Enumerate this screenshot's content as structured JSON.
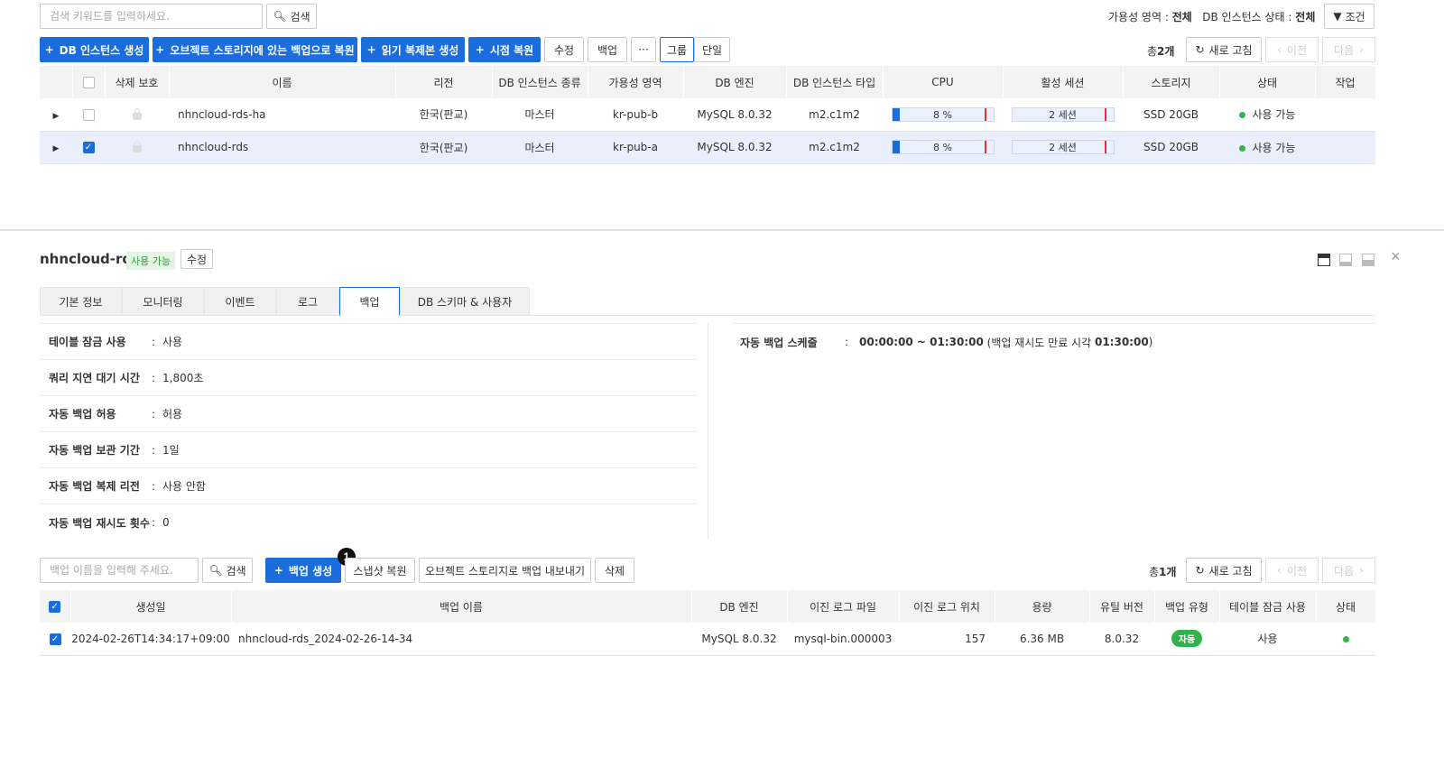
{
  "top": {
    "search_placeholder": "검색 키워드를 입력하세요.",
    "search_button": "검색",
    "filter_zone_label": "가용성 영역 :",
    "filter_zone_value": "전체",
    "filter_status_label": "DB 인스턴스 상태 :",
    "filter_status_value": "전체",
    "condition_button": "조건"
  },
  "toolbar": {
    "create_instance": "DB 인스턴스 생성",
    "restore_object_storage": "오브젝트 스토리지에 있는 백업으로 복원",
    "create_read_replica": "읽기 복제본 생성",
    "point_in_time_restore": "시점 복원",
    "edit": "수정",
    "backup": "백업",
    "more": "···",
    "group": "그룹",
    "single": "단일",
    "total_prefix": "총",
    "total_count": "2개",
    "refresh": "새로 고침",
    "prev": "이전",
    "next": "다음"
  },
  "instances_table": {
    "headers": [
      "삭제 보호",
      "이름",
      "리전",
      "DB 인스턴스 종류",
      "가용성 영역",
      "DB 엔진",
      "DB 인스턴스 타입",
      "CPU",
      "활성 세션",
      "스토리지",
      "상태",
      "작업"
    ],
    "rows": [
      {
        "name": "nhncloud-rds-ha",
        "region": "한국(판교)",
        "kind": "마스터",
        "zone": "kr-pub-b",
        "engine": "MySQL 8.0.32",
        "type": "m2.c1m2",
        "cpu": "8 %",
        "cpu_pct": 8,
        "sessions": "2 세션",
        "storage": "SSD 20GB",
        "status": "사용 가능",
        "checked": false
      },
      {
        "name": "nhncloud-rds",
        "region": "한국(판교)",
        "kind": "마스터",
        "zone": "kr-pub-a",
        "engine": "MySQL 8.0.32",
        "type": "m2.c1m2",
        "cpu": "8 %",
        "cpu_pct": 8,
        "sessions": "2 세션",
        "storage": "SSD 20GB",
        "status": "사용 가능",
        "checked": true
      }
    ]
  },
  "detail": {
    "title": "nhncloud-rds",
    "status_badge": "사용 가능",
    "edit_button": "수정",
    "tabs": [
      "기본 정보",
      "모니터링",
      "이벤트",
      "로그",
      "백업",
      "DB 스키마 & 사용자"
    ],
    "info_left": [
      {
        "key": "테이블 잠금 사용",
        "value": "사용"
      },
      {
        "key": "쿼리 지연 대기 시간",
        "value": "1,800초"
      },
      {
        "key": "자동 백업 허용",
        "value": "허용"
      },
      {
        "key": "자동 백업 보관 기간",
        "value": "1일"
      },
      {
        "key": "자동 백업 복제 리전",
        "value": "사용 안함"
      },
      {
        "key": "자동 백업 재시도 횟수",
        "value": "0"
      }
    ],
    "schedule_key": "자동 백업 스케줄",
    "schedule_time": "00:00:00 ~ 01:30:00",
    "schedule_suffix_prefix": "(백업 재시도 만료 시각",
    "schedule_expiry": "01:30:00",
    "schedule_suffix_close": ")"
  },
  "backup_toolbar": {
    "search_placeholder": "백업 이름을 입력해 주세요.",
    "search_button": "검색",
    "create_backup": "백업 생성",
    "callout_number": "1",
    "snapshot_restore": "스냅샷 복원",
    "export_object_storage": "오브젝트 스토리지로 백업 내보내기",
    "delete": "삭제",
    "total_prefix": "총",
    "total_count": "1개",
    "refresh": "새로 고침",
    "prev": "이전",
    "next": "다음"
  },
  "backups_table": {
    "headers": [
      "생성일",
      "백업 이름",
      "DB 엔진",
      "이진 로그 파일",
      "이진 로그 위치",
      "용량",
      "유틸 버전",
      "백업 유형",
      "테이블 잠금 사용",
      "상태"
    ],
    "rows": [
      {
        "created": "2024-02-26T14:34:17+09:00",
        "name": "nhncloud-rds_2024-02-26-14-34",
        "engine": "MySQL 8.0.32",
        "binlog_file": "mysql-bin.000003",
        "binlog_pos": "157",
        "size": "6.36 MB",
        "util_version": "8.0.32",
        "type": "자동",
        "table_lock": "사용"
      }
    ]
  },
  "colors": {
    "accent": "#1a6ddb",
    "status_green": "#2fb34a"
  }
}
